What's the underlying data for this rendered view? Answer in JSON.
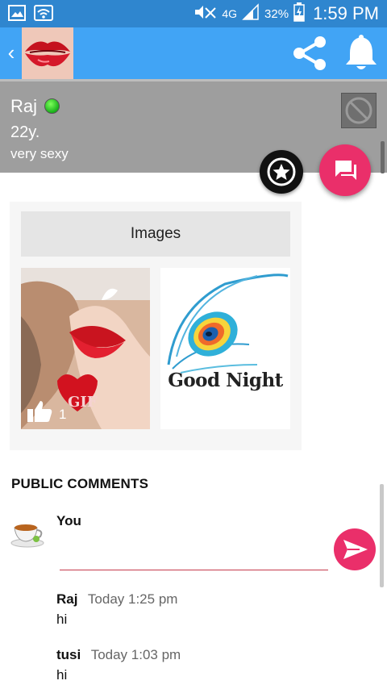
{
  "status_bar": {
    "network": "4G",
    "battery": "32%",
    "time": "1:59 PM",
    "icons": [
      "gallery-icon",
      "wifi-icon",
      "mute-icon",
      "signal-icon",
      "battery-charging-icon"
    ]
  },
  "app_bar": {
    "icons": [
      "back-icon",
      "share-icon",
      "bell-icon"
    ],
    "color": "#41a4f5"
  },
  "profile": {
    "name": "Raj",
    "age": "22y.",
    "status": "very sexy",
    "online": true
  },
  "images": {
    "tab_label": "Images",
    "items": [
      {
        "kind": "gif",
        "badge": "GIF",
        "likes": "1"
      },
      {
        "kind": "image",
        "caption": "Good Night"
      }
    ]
  },
  "comments": {
    "title": "PUBLIC COMMENTS",
    "input_author": "You",
    "input_value": "",
    "list": [
      {
        "author": "Raj",
        "time": "Today 1:25 pm",
        "text": "hi"
      },
      {
        "author": "tusi",
        "time": "Today 1:03 pm",
        "text": "hi"
      }
    ]
  },
  "colors": {
    "status_bar": "#2f86cf",
    "accent_pink": "#ea2f6a",
    "profile_bg": "#9e9e9e",
    "online_green": "#18b01a"
  }
}
